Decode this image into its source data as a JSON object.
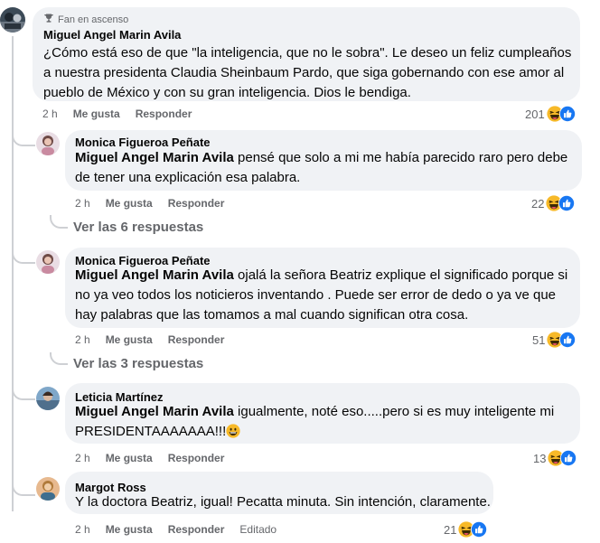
{
  "main_comment": {
    "badge": "Fan en ascenso",
    "author": "Miguel Angel Marin Avila",
    "text": "¿Cómo está eso de que \"la inteligencia, que no le sobra\". Le deseo un feliz cumpleaños a nuestra presidenta Claudia Sheinbaum Pardo, que siga gobernando con ese amor al pueblo de México y con su gran inteligencia. Dios le bendiga.",
    "time": "2 h",
    "like": "Me gusta",
    "reply": "Responder",
    "reactions": "201"
  },
  "replies": [
    {
      "author": "Monica Figueroa Peñate",
      "mention": "Miguel Angel Marin Avila",
      "text": " pensé que solo a mi me había parecido raro pero debe de tener una explicación esa palabra.",
      "time": "2 h",
      "like": "Me gusta",
      "reply": "Responder",
      "reactions": "22",
      "more": "Ver las 6 respuestas"
    },
    {
      "author": "Monica Figueroa Peñate",
      "mention": "Miguel Angel Marin Avila",
      "text": " ojalá la señora Beatriz explique el significado porque si no ya veo todos los noticieros inventando . Puede ser error de dedo o ya ve que hay palabras que las tomamos a mal cuando significan otra cosa.",
      "time": "2 h",
      "like": "Me gusta",
      "reply": "Responder",
      "reactions": "51",
      "more": "Ver las 3 respuestas"
    },
    {
      "author": "Leticia Martínez",
      "mention": "Miguel Angel Marin Avila",
      "text": " igualmente, noté eso.....pero si es muy inteligente mi PRESIDENTAAAAAAA!!!",
      "time": "2 h",
      "like": "Me gusta",
      "reply": "Responder",
      "reactions": "13"
    },
    {
      "author": "Margot Ross",
      "text": "Y la doctora Beatriz, igual! Pecatta minuta. Sin intención, claramente.",
      "time": "2 h",
      "like": "Me gusta",
      "reply": "Responder",
      "edited": "Editado",
      "reactions": "21"
    }
  ],
  "icons": {
    "badge": "trophy-icon",
    "reaction_haha": "haha-emoji-icon",
    "reaction_like": "like-icon",
    "inline_emoji": "grinning-emoji-icon"
  },
  "colors": {
    "bubble": "#f0f2f5",
    "secondary_text": "#65676b",
    "like_blue": "#1877f2",
    "haha_yellow": "#f7b928"
  }
}
